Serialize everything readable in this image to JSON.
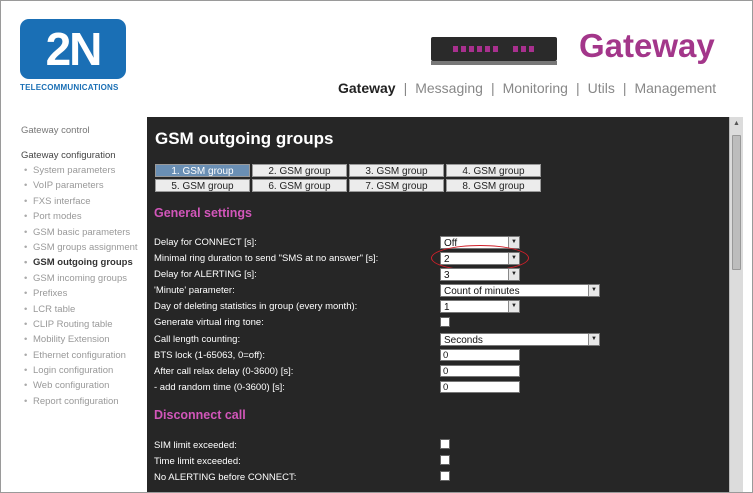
{
  "brand": {
    "logo_text": "2N",
    "logo_sub": "TELECOMMUNICATIONS",
    "product": "Gateway",
    "accent": "#a3368a",
    "logo_color": "#1a6fb5"
  },
  "topnav": [
    "Gateway",
    "Messaging",
    "Monitoring",
    "Utils",
    "Management"
  ],
  "sidebar": {
    "control": "Gateway control",
    "config": "Gateway configuration",
    "items": [
      "System parameters",
      "VoIP parameters",
      "FXS interface",
      "Port modes",
      "GSM basic parameters",
      "GSM groups assignment",
      "GSM outgoing groups",
      "GSM incoming groups",
      "Prefixes",
      "LCR table",
      "CLIP Routing table",
      "Mobility Extension",
      "Ethernet configuration",
      "Login configuration",
      "Web configuration",
      "Report configuration"
    ]
  },
  "page": {
    "title": "GSM outgoing groups",
    "tabs": [
      "1. GSM group",
      "2. GSM group",
      "3. GSM group",
      "4. GSM group",
      "5. GSM group",
      "6. GSM group",
      "7. GSM group",
      "8. GSM group"
    ],
    "general": {
      "heading": "General settings",
      "fields": [
        {
          "label": "Delay for CONNECT [s]:",
          "value": "Off"
        },
        {
          "label": "Minimal ring duration to send \"SMS at no answer\" [s]:",
          "value": "2"
        },
        {
          "label": "Delay for ALERTING [s]:",
          "value": "3"
        },
        {
          "label": "'Minute' parameter:",
          "value": "Count of minutes"
        },
        {
          "label": "Day of deleting statistics in group (every month):",
          "value": "1"
        },
        {
          "label": "Generate virtual ring tone:",
          "value": ""
        },
        {
          "label": "Call length counting:",
          "value": "Seconds"
        },
        {
          "label": "BTS lock (1-65063, 0=off):",
          "value": "0"
        },
        {
          "label": "After call relax delay (0-3600) [s]:",
          "value": "0"
        },
        {
          "label": "- add random time (0-3600) [s]:",
          "value": "0"
        }
      ]
    },
    "disconnect": {
      "heading": "Disconnect call",
      "fields": [
        {
          "label": "SIM limit exceeded:"
        },
        {
          "label": "Time limit exceeded:"
        },
        {
          "label": "No ALERTING before CONNECT:"
        }
      ]
    }
  }
}
